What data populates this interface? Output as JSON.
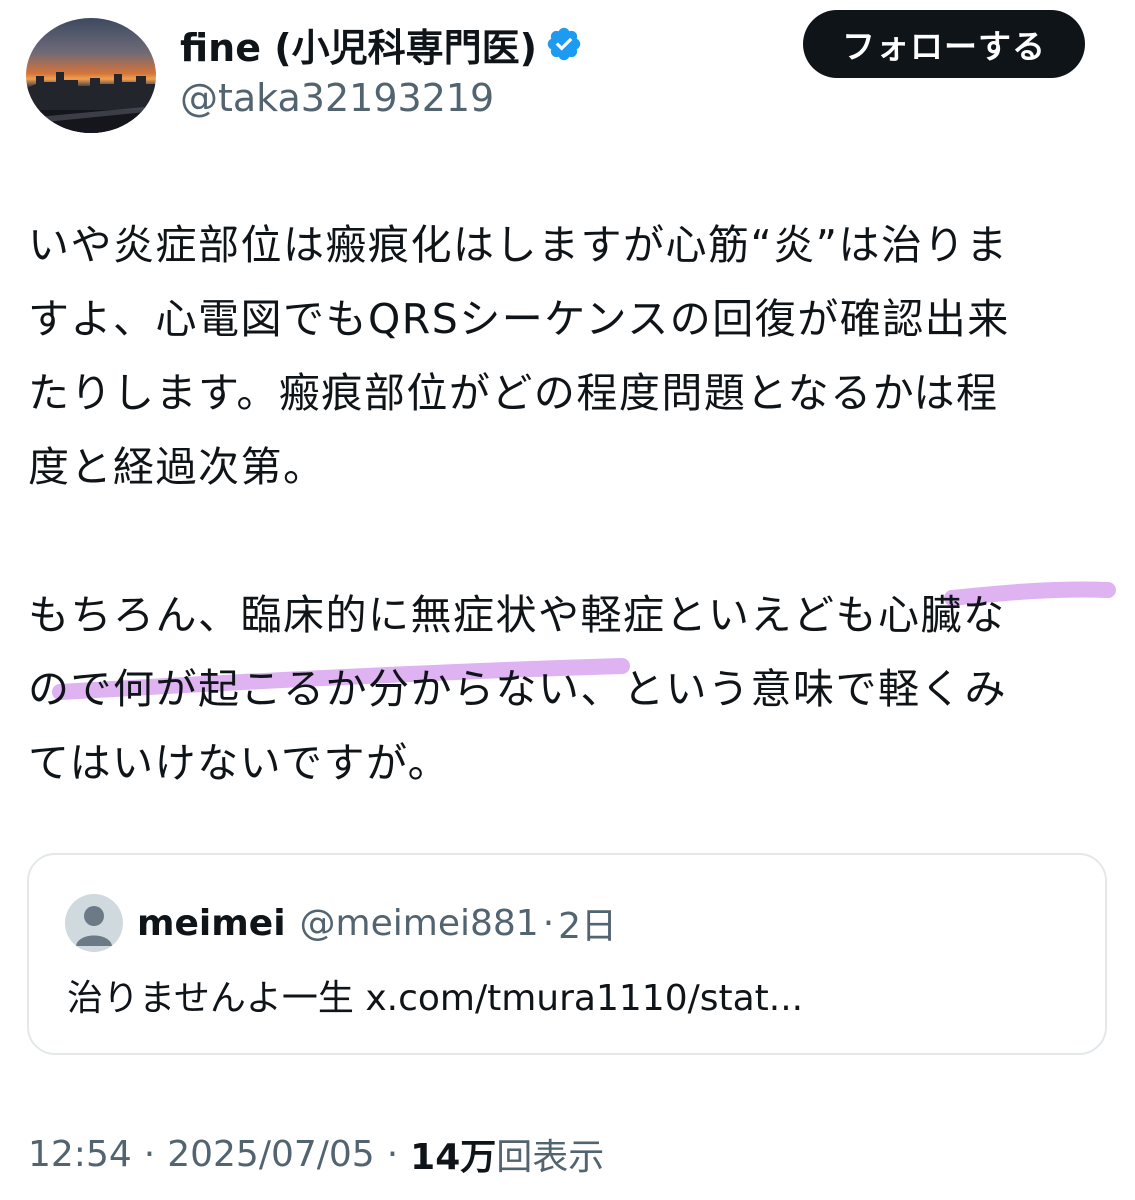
{
  "author": {
    "display_name": "fine (小児科専門医)",
    "handle": "@taka32193219",
    "verified_icon": "verified-badge-icon",
    "verified_color": "#1d9bf0"
  },
  "follow_button": {
    "label": "フォローする"
  },
  "post": {
    "paragraphs": [
      "いや炎症部位は瘢痕化はしますが心筋“炎”は治りま\nすよ、心電図でもQRSシーケンスの回復が確認出来\nたりします。瘢痕部位がどの程度問題となるかは程\n度と経過次第。",
      "もちろん、臨床的に無症状や軽症といえども心臓な\nので何が起こるか分からない、という意味で軽くみ\nてはいけないですが。"
    ],
    "highlight_color": "#d9a4f0"
  },
  "quote": {
    "avatar_icon": "default-user-icon",
    "name": "meimei",
    "handle": "@meimei881",
    "separator": "·",
    "time": "2日",
    "text": "治りませんよ一生 x.com/tmura1110/stat..."
  },
  "meta": {
    "time": "12:54",
    "separator": "·",
    "date": "2025/07/05",
    "views_count": "14万",
    "views_label": "回表示"
  }
}
